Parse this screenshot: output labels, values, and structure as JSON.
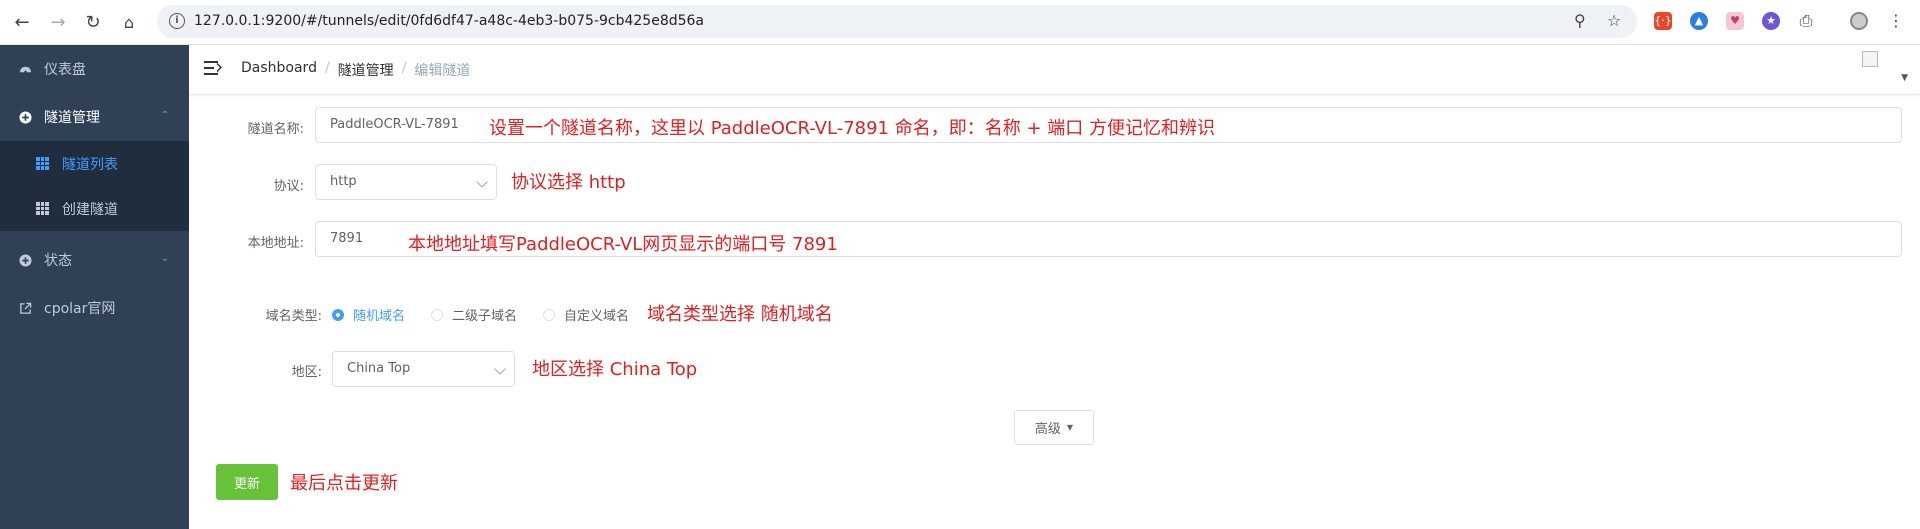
{
  "browser": {
    "url": "127.0.0.1:9200/#/tunnels/edit/0fd6df47-a48c-4eb3-b075-9cb425e8d56a",
    "icons": [
      "back-icon",
      "forward-icon",
      "reload-icon",
      "home-icon",
      "zoom-icon",
      "bookmark-star-icon",
      "extensions-icon",
      "profile-icon",
      "menu-icon"
    ]
  },
  "sidebar": {
    "items": [
      {
        "label": "仪表盘",
        "icon": "dashboard-icon"
      },
      {
        "label": "隧道管理",
        "icon": "plus-circle-icon"
      },
      {
        "label": "状态",
        "icon": "plus-circle-icon"
      },
      {
        "label": "cpolar官网",
        "icon": "external-link-icon"
      }
    ],
    "submenu": [
      {
        "label": "隧道列表",
        "active": true
      },
      {
        "label": "创建隧道",
        "active": false
      }
    ]
  },
  "breadcrumb": [
    "Dashboard",
    "隧道管理",
    "编辑隧道"
  ],
  "form": {
    "name_label": "隧道名称:",
    "name_value": "PaddleOCR-VL-7891",
    "protocol_label": "协议:",
    "protocol_value": "http",
    "local_label": "本地地址:",
    "local_value": "7891",
    "domain_type_label": "域名类型:",
    "domain_options": [
      "随机域名",
      "二级子域名",
      "自定义域名"
    ],
    "domain_selected": "随机域名",
    "region_label": "地区:",
    "region_value": "China Top",
    "advanced_label": "高级",
    "update_label": "更新"
  },
  "annotations": {
    "name": "设置一个隧道名称，这里以 PaddleOCR-VL-7891 命名，即：名称 + 端口 方便记忆和辨识",
    "protocol": "协议选择 http",
    "local": "本地地址填写PaddleOCR-VL网页显示的端口号 7891",
    "domain": "域名类型选择 随机域名",
    "region": "地区选择  China Top",
    "update": "最后点击更新"
  },
  "colors": {
    "sidebar_bg": "#304156",
    "submenu_bg": "#1f2d3d",
    "accent": "#409eff",
    "update_button": "#67c23a",
    "annotation": "#e02020"
  }
}
